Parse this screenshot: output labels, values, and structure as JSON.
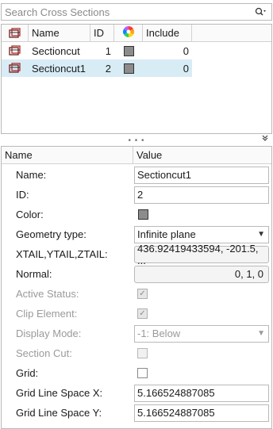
{
  "search": {
    "placeholder": "Search Cross Sections"
  },
  "list": {
    "columns": {
      "name": "Name",
      "id": "ID",
      "include": "Include"
    },
    "rows": [
      {
        "name": "Sectioncut",
        "id": "1",
        "include": "0",
        "selected": false
      },
      {
        "name": "Sectioncut1",
        "id": "2",
        "include": "0",
        "selected": true
      }
    ]
  },
  "splitter": {
    "dots": "• • •"
  },
  "props": {
    "header": {
      "name": "Name",
      "value": "Value"
    },
    "name_label": "Name:",
    "name_value": "Sectioncut1",
    "id_label": "ID:",
    "id_value": "2",
    "color_label": "Color:",
    "geometry_label": "Geometry type:",
    "geometry_value": "Infinite plane",
    "tail_label": "XTAIL,YTAIL,ZTAIL:",
    "tail_value": "436.92419433594, -201.5, ...",
    "normal_label": "Normal:",
    "normal_value": "0, 1, 0",
    "active_label": "Active Status:",
    "clip_label": "Clip Element:",
    "display_label": "Display Mode:",
    "display_value": "-1: Below",
    "sectioncut_label": "Section Cut:",
    "grid_label": "Grid:",
    "gridx_label": "Grid Line Space X:",
    "gridx_value": "5.166524887085",
    "gridy_label": "Grid Line Space Y:",
    "gridy_value": "5.166524887085"
  },
  "colors": {
    "selected_row": "#d8ecf6",
    "swatch": "#8c8c8c"
  }
}
